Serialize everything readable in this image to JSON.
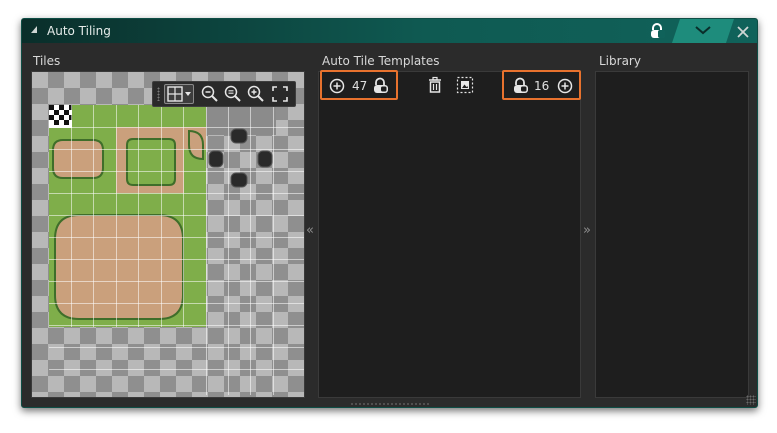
{
  "window": {
    "title": "Auto Tiling",
    "accent_color": "#10625a",
    "icons": {
      "collapse": "triangle-up-icon",
      "lock": "padlock-icon",
      "tab": "chevron-down-icon",
      "close": "close-icon"
    }
  },
  "panels": {
    "tiles": {
      "title": "Tiles",
      "toolbar": [
        {
          "icon": "grid-toggle-icon"
        },
        {
          "icon": "dropdown-arrow-icon"
        },
        {
          "icon": "zoom-out-icon"
        },
        {
          "icon": "zoom-reset-icon"
        },
        {
          "icon": "zoom-in-icon"
        },
        {
          "icon": "fullscreen-icon"
        }
      ]
    },
    "templates": {
      "title": "Auto Tile Templates",
      "left_group": {
        "count": "47",
        "icons": [
          "add-icon",
          "padlock-icon"
        ]
      },
      "center_icons": [
        "delete-icon",
        "select-image-icon"
      ],
      "right_group": {
        "count": "16",
        "icons": [
          "padlock-icon",
          "add-icon"
        ]
      },
      "highlight_color": "#e8722e"
    },
    "library": {
      "title": "Library"
    }
  },
  "splitters": {
    "left_label": "«",
    "right_label": "»"
  }
}
